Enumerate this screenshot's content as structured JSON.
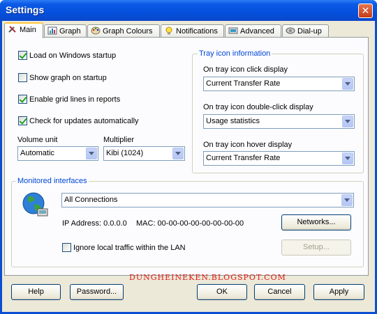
{
  "window": {
    "title": "Settings",
    "close_glyph": "✕"
  },
  "tabs": [
    {
      "label": "Main",
      "icon": "tools-icon",
      "active": true
    },
    {
      "label": "Graph",
      "icon": "graph-icon"
    },
    {
      "label": "Graph Colours",
      "icon": "palette-icon"
    },
    {
      "label": "Notifications",
      "icon": "bulb-icon"
    },
    {
      "label": "Advanced",
      "icon": "advanced-icon"
    },
    {
      "label": "Dial-up",
      "icon": "dialup-icon"
    }
  ],
  "main": {
    "options": [
      {
        "label": "Load on Windows startup",
        "checked": true
      },
      {
        "label": "Show graph on startup",
        "checked": false
      },
      {
        "label": "Enable grid lines in reports",
        "checked": true
      },
      {
        "label": "Check for updates automatically",
        "checked": true
      }
    ],
    "volume_unit": {
      "label": "Volume unit",
      "value": "Automatic"
    },
    "multiplier": {
      "label": "Multiplier",
      "value": "Kibi (1024)"
    },
    "tray": {
      "title": "Tray icon information",
      "click_label": "On tray icon click display",
      "click_value": "Current Transfer Rate",
      "dblclick_label": "On tray icon double-click display",
      "dblclick_value": "Usage statistics",
      "hover_label": "On tray icon hover display",
      "hover_value": "Current Transfer Rate"
    },
    "monitored": {
      "title": "Monitored interfaces",
      "interface_value": "All Connections",
      "ip_text": "IP Address: 0.0.0.0",
      "mac_text": "MAC: 00-00-00-00-00-00-00-00",
      "networks_button": "Networks...",
      "ignore_label": "Ignore local traffic within the LAN",
      "ignore_checked": false,
      "setup_button": "Setup..."
    },
    "watermark": "DUNGHEINEKEN.BLOGSPOT.COM"
  },
  "footer": {
    "help": "Help",
    "password": "Password...",
    "ok": "OK",
    "cancel": "Cancel",
    "apply": "Apply"
  }
}
